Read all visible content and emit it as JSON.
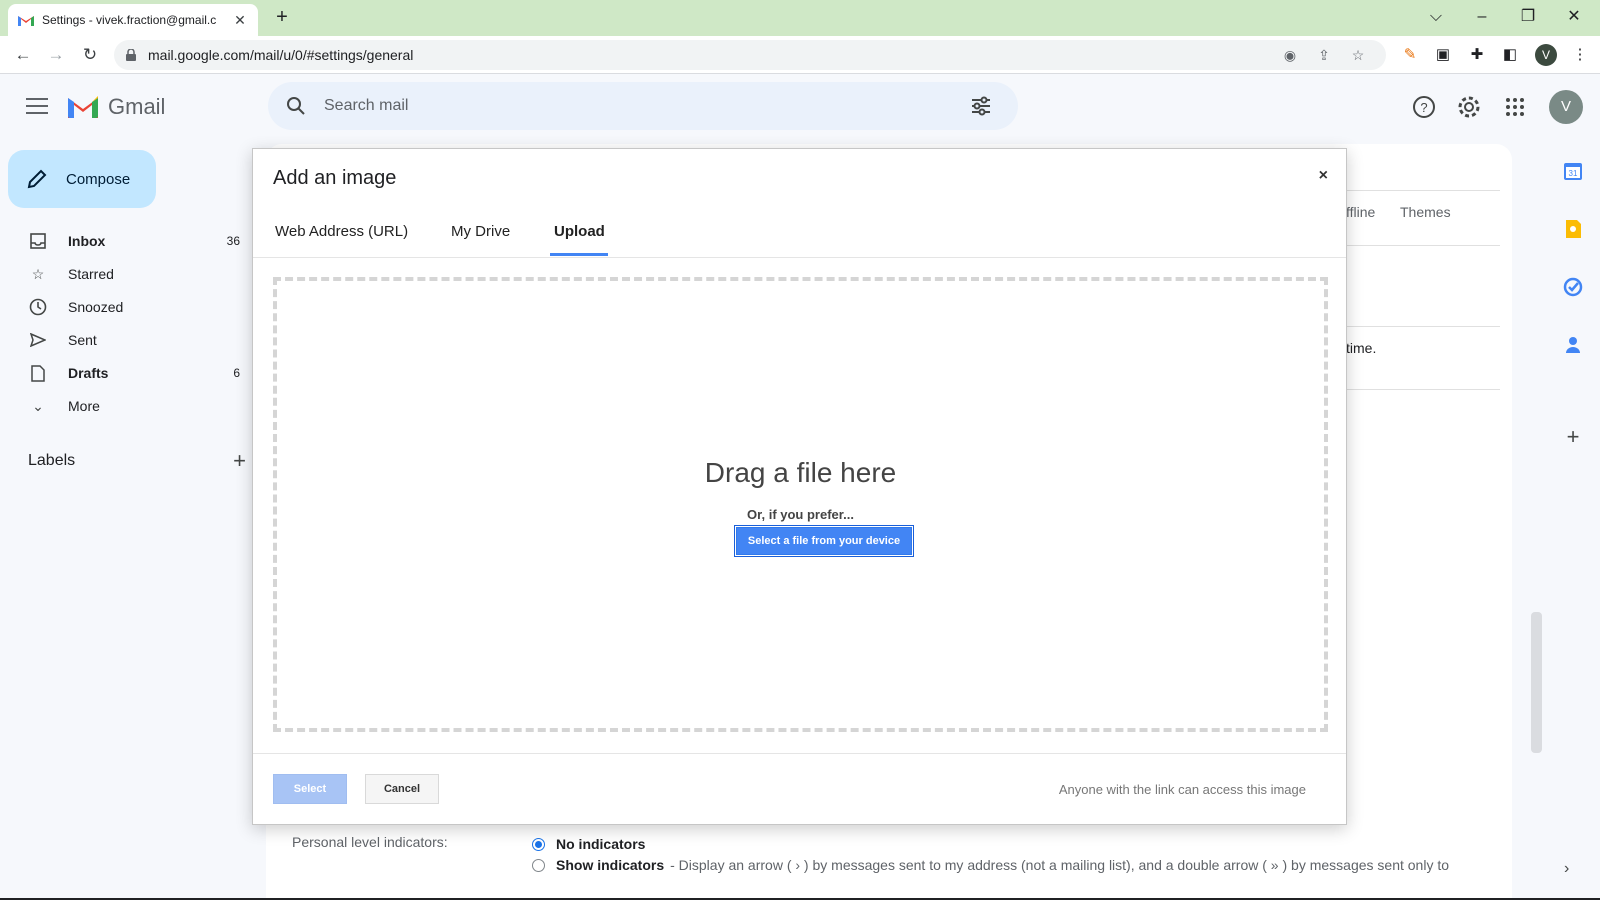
{
  "browser": {
    "tab_title": "Settings - vivek.fraction@gmail.c",
    "url": "mail.google.com/mail/u/0/#settings/general",
    "profile_initial": "V"
  },
  "gmail": {
    "app_name": "Gmail",
    "search_placeholder": "Search mail",
    "avatar_initial": "V",
    "compose_label": "Compose",
    "nav": [
      {
        "label": "Inbox",
        "count": "36",
        "icon": "inbox-icon"
      },
      {
        "label": "Starred",
        "count": "",
        "icon": "star-icon"
      },
      {
        "label": "Snoozed",
        "count": "",
        "icon": "clock-icon"
      },
      {
        "label": "Sent",
        "count": "",
        "icon": "send-icon"
      },
      {
        "label": "Drafts",
        "count": "6",
        "icon": "draft-icon"
      },
      {
        "label": "More",
        "count": "",
        "icon": "chevron-down-icon"
      }
    ],
    "labels_heading": "Labels"
  },
  "settings_background": {
    "tab_offline_partial": "ffline",
    "tab_themes": "Themes",
    "partial_text": "time.",
    "personal_level_label": "Personal level indicators:",
    "option_no_indicators": "No indicators",
    "option_show_indicators": "Show indicators",
    "option_show_desc": "- Display an arrow ( › ) by messages sent to my address (not a mailing list), and a double arrow ( » ) by messages sent only to"
  },
  "dialog": {
    "title": "Add an image",
    "close_symbol": "×",
    "tabs": [
      "Web Address (URL)",
      "My Drive",
      "Upload"
    ],
    "active_tab": "Upload",
    "drag_title": "Drag a file here",
    "prefer_text": "Or, if you prefer...",
    "select_file_button": "Select a file from your device",
    "select_button": "Select",
    "cancel_button": "Cancel",
    "access_note": "Anyone with the link can access this image"
  },
  "colors": {
    "tabbar_bg": "#cfe8c6",
    "compose_bg": "#c2e7ff",
    "primary_blue": "#4285f4"
  }
}
